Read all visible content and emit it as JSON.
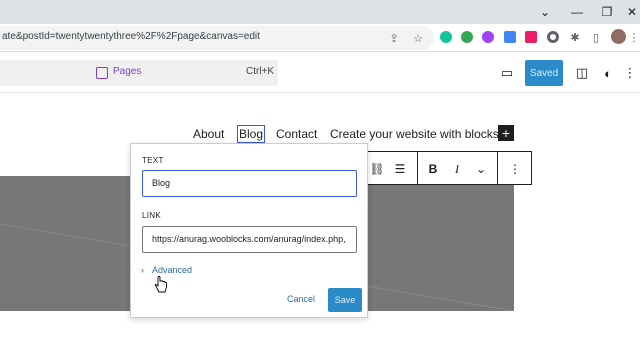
{
  "browser": {
    "url": "ate&postId=twentytwentythree%2F%2Fpage&canvas=edit"
  },
  "wp_header": {
    "command_label": "Pages",
    "command_shortcut": "Ctrl+K",
    "saved_label": "Saved"
  },
  "nav": {
    "items": [
      "About",
      "Blog",
      "Contact",
      "Create your website with blocks"
    ],
    "selected": "Blog"
  },
  "popover": {
    "text_label": "TEXT",
    "text_value": "Blog",
    "link_label": "LINK",
    "link_value": "https://anurag.wooblocks.com/anurag/index.php,",
    "advanced_label": "Advanced",
    "cancel_label": "Cancel",
    "save_label": "Save"
  },
  "colors": {
    "accent": "#2b8bc8",
    "selection": "#3858e9",
    "pages_purple": "#7b3fd6"
  }
}
